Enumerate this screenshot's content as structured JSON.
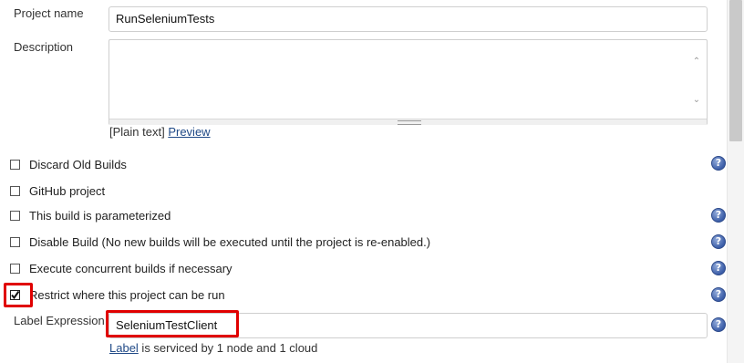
{
  "project_name": {
    "label": "Project name",
    "value": "RunSeleniumTests"
  },
  "description": {
    "label": "Description",
    "value": "",
    "format_prefix": "[Plain text]",
    "preview_link": "Preview"
  },
  "options": [
    {
      "label": "Discard Old Builds",
      "checked": false,
      "has_help": true
    },
    {
      "label": "GitHub project",
      "checked": false,
      "has_help": false
    },
    {
      "label": "This build is parameterized",
      "checked": false,
      "has_help": true
    },
    {
      "label": "Disable Build (No new builds will be executed until the project is re-enabled.)",
      "checked": false,
      "has_help": true
    },
    {
      "label": "Execute concurrent builds if necessary",
      "checked": false,
      "has_help": true
    },
    {
      "label": "Restrict where this project can be run",
      "checked": true,
      "has_help": true
    }
  ],
  "label_expression": {
    "label": "Label Expression",
    "value": "SeleniumTestClient",
    "status_link": "Label",
    "status_text": " is serviced by 1 node and 1 cloud"
  },
  "icons": {
    "help": "help-icon",
    "check": "checkmark-icon"
  },
  "colors": {
    "link": "#204a87",
    "highlight": "#e00000",
    "help_icon": "#3b5da8"
  }
}
